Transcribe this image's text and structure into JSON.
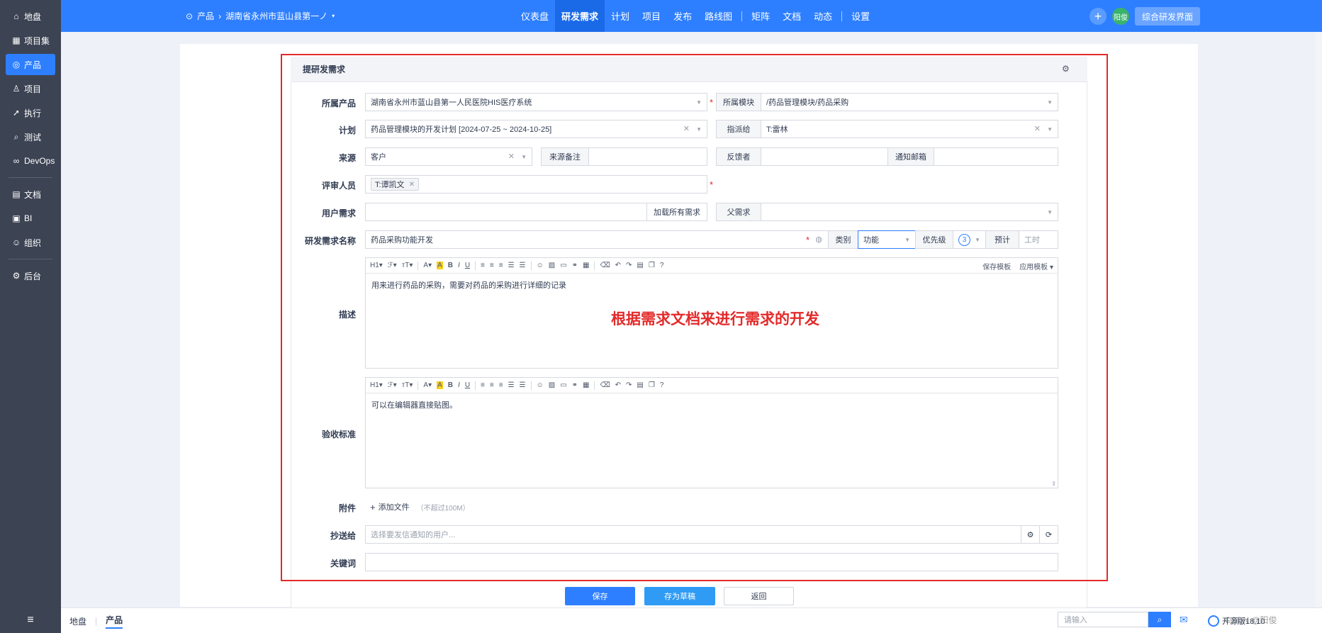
{
  "sidebar": {
    "items": [
      {
        "label": "地盘",
        "icon": "home-icon"
      },
      {
        "label": "项目集",
        "icon": "grid-icon"
      },
      {
        "label": "产品",
        "icon": "product-icon"
      },
      {
        "label": "项目",
        "icon": "project-icon"
      },
      {
        "label": "执行",
        "icon": "run-icon"
      },
      {
        "label": "测试",
        "icon": "search-icon"
      },
      {
        "label": "DevOps",
        "icon": "infinity-icon"
      },
      {
        "label": "文档",
        "icon": "doc-icon"
      },
      {
        "label": "BI",
        "icon": "chart-icon"
      },
      {
        "label": "组织",
        "icon": "org-icon"
      },
      {
        "label": "后台",
        "icon": "gear-icon"
      }
    ],
    "menu_icon": "≡"
  },
  "header": {
    "breadcrumb": {
      "module": "产品",
      "product": "湖南省永州市蓝山县第一ノ"
    },
    "nav": [
      "仪表盘",
      "研发需求",
      "计划",
      "项目",
      "发布",
      "路线图",
      "矩阵",
      "文档",
      "动态",
      "设置"
    ],
    "avatar_text": "阳俊",
    "overview_button": "综合研发界面"
  },
  "panel": {
    "title": "提研发需求"
  },
  "form": {
    "product": {
      "label": "所属产品",
      "value": "湖南省永州市蓝山县第一人民医院HIS医疗系统"
    },
    "module": {
      "label": "所属模块",
      "value": "/药品管理模块/药品采购"
    },
    "plan": {
      "label": "计划",
      "value": "药品管理模块的开发计划 [2024-07-25 ~ 2024-10-25]"
    },
    "assign": {
      "label": "指派给",
      "value": "T:雷林"
    },
    "source": {
      "label": "来源",
      "value": "客户"
    },
    "source_note": {
      "label": "来源备注",
      "value": ""
    },
    "feedback": {
      "label": "反馈者",
      "value": ""
    },
    "notify_email": {
      "label": "通知邮箱",
      "value": ""
    },
    "reviewer": {
      "label": "评审人员",
      "tag": "T:谭凯文"
    },
    "user_req": {
      "label": "用户需求",
      "load_button": "加载所有需求"
    },
    "parent": {
      "label": "父需求",
      "value": ""
    },
    "name": {
      "label": "研发需求名称",
      "value": "药品采购功能开发"
    },
    "category": {
      "label": "类别",
      "value": "功能"
    },
    "priority": {
      "label": "优先级",
      "value": "3"
    },
    "estimate": {
      "label": "预计",
      "placeholder": "工时"
    },
    "desc": {
      "label": "描述",
      "text": "用来进行药品的采购，需要对药品的采购进行详细的记录"
    },
    "toolbar": {
      "save_template": "保存模板",
      "apply_template": "应用模板"
    },
    "acceptance": {
      "label": "验收标准",
      "placeholder": "可以在编辑器直接贴图。"
    },
    "attachment": {
      "label": "附件",
      "add": "添加文件",
      "limit": "（不超过100M）"
    },
    "cc": {
      "label": "抄送给",
      "placeholder": "选择要发信通知的用户..."
    },
    "keywords": {
      "label": "关键词",
      "value": ""
    }
  },
  "annotation": "根据需求文档来进行需求的开发",
  "actions": {
    "save": "保存",
    "draft": "存为草稿",
    "back": "返回"
  },
  "footer": {
    "crumbs": [
      "地盘",
      "产品"
    ],
    "search_placeholder": "请输入",
    "version": "开源版18.10"
  },
  "watermark": "CSDN @阳俊",
  "colors": {
    "primary": "#2e7fff",
    "sidebar": "#3c4353",
    "required": "#e32a2a"
  }
}
